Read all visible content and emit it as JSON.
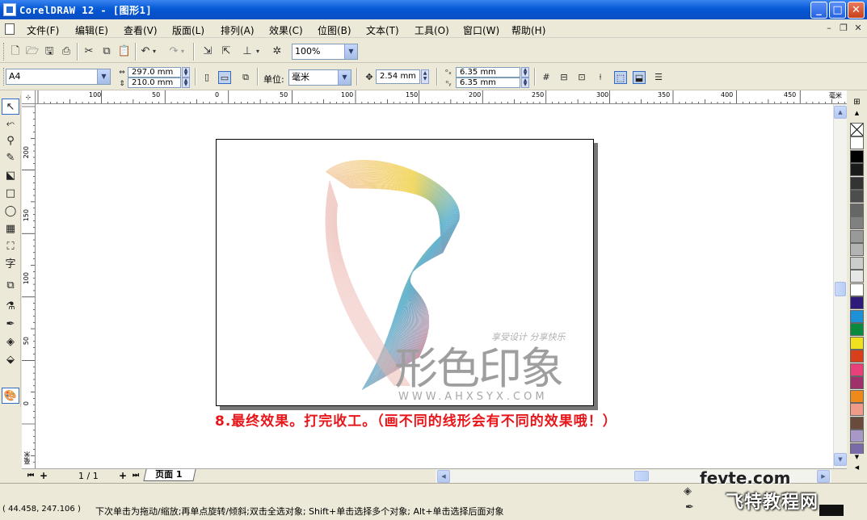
{
  "window": {
    "title": "CorelDRAW 12 - [图形1]",
    "minimize": "_",
    "maximize": "□",
    "close": "✕"
  },
  "menu": [
    {
      "label": "文件(F)"
    },
    {
      "label": "编辑(E)"
    },
    {
      "label": "查看(V)"
    },
    {
      "label": "版面(L)"
    },
    {
      "label": "排列(A)"
    },
    {
      "label": "效果(C)"
    },
    {
      "label": "位图(B)"
    },
    {
      "label": "文本(T)"
    },
    {
      "label": "工具(O)"
    },
    {
      "label": "窗口(W)"
    },
    {
      "label": "帮助(H)"
    }
  ],
  "toolbar": {
    "zoom_value": "100%"
  },
  "property_bar": {
    "paper_size": "A4",
    "width": "297.0 mm",
    "height": "210.0 mm",
    "units_label": "单位:",
    "units_value": "毫米",
    "nudge": "2.54 mm",
    "dup_x": "6.35 mm",
    "dup_y": "6.35 mm"
  },
  "rulers": {
    "h_ticks": [
      "100",
      "50",
      "0",
      "50",
      "100",
      "150",
      "200",
      "250",
      "300",
      "350",
      "400",
      "450"
    ],
    "h_unit": "毫米",
    "v_ticks": [
      "200",
      "150",
      "100",
      "50",
      "0"
    ],
    "v_unit": "毫米"
  },
  "canvas": {
    "caption": "8.最终效果。打完收工。（画不同的线形会有不同的效果哦！）",
    "artwork": {
      "slogan": "享受设计 分享快乐",
      "logo_text": "形色印象",
      "url": "WWW.AHXSYX.COM"
    }
  },
  "palette": [
    "#ffffff",
    "#000000",
    "#1a1a1a",
    "#333333",
    "#4d4d4d",
    "#666666",
    "#808080",
    "#999999",
    "#b3b3b3",
    "#cccccc",
    "#e6e6e6",
    "#ffffff",
    "#2e1a78",
    "#1e90d6",
    "#0a8a3c",
    "#f0e020",
    "#d8401c",
    "#e8407a",
    "#a0306a",
    "#ee8a1c",
    "#f09a8a",
    "#6a4a3a",
    "#a898c8",
    "#7a6aa8"
  ],
  "page_nav": {
    "page_count": "1 / 1",
    "page_tab": "页面 1"
  },
  "status": {
    "coords": "( 44.458, 247.106 )",
    "hint": "下次单击为拖动/缩放;再单点旋转/倾斜;双击全选对象; Shift+单击选择多个对象; Alt+单击选择后面对象"
  },
  "watermarks": {
    "site": "fevte.com",
    "site_cn": "飞特教程网"
  }
}
